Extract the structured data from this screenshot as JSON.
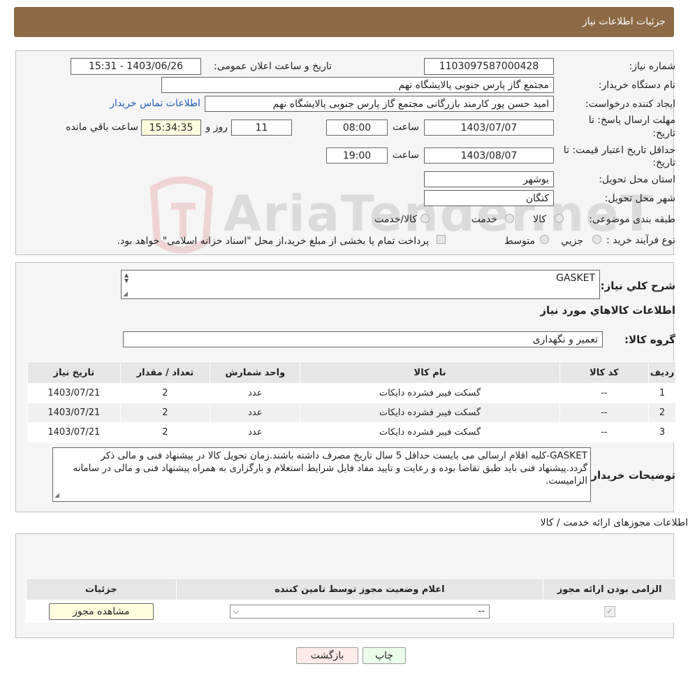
{
  "header": {
    "title": "جزئیات اطلاعات نیاز"
  },
  "form": {
    "need_number_label": "شماره نیاز:",
    "need_number": "1103097587000428",
    "announce_label": "تاریخ و ساعت اعلان عمومی:",
    "announce_value": "1403/06/26 - 15:31",
    "buyer_org_label": "نام دستگاه خریدار:",
    "buyer_org": "مجتمع گاز پارس جنوبی  پالایشگاه نهم",
    "creator_label": "ایجاد کننده درخواست:",
    "creator": "امید حسن پور کارمند بازرگانی مجتمع گاز پارس جنوبی  پالایشگاه نهم",
    "contact_link": "اطلاعات تماس خریدار",
    "deadline_label_1": "مهلت ارسال پاسخ: تا",
    "deadline_label_2": "تاریخ:",
    "deadline_date": "1403/07/07",
    "time_label": "ساعت",
    "deadline_time": "08:00",
    "days_value": "11",
    "days_label": "روز و",
    "remaining_time": "15:34:35",
    "remaining_label": "ساعت باقي مانده",
    "validity_label_1": "حداقل تاریخ اعتبار قیمت: تا",
    "validity_label_2": "تاریخ:",
    "validity_date": "1403/08/07",
    "validity_time": "19:00",
    "province_label": "استان محل تحویل:",
    "province": "بوشهر",
    "city_label": "شهر محل تحویل:",
    "city": "کنگان",
    "category_label": "طبقه بندی موضوعی:",
    "category_options": [
      "کالا",
      "خدمت",
      "کالا/خدمت"
    ],
    "process_label": "نوع فرآیند خرید :",
    "process_options": [
      "جزیي",
      "متوسط"
    ],
    "process_note": "پرداخت تمام یا بخشی از مبلغ خرید،از محل \"اسناد خزانه اسلامی\" خواهد بود."
  },
  "details": {
    "summary_label": "شرح كلي نياز:",
    "summary_value": "GASKET",
    "goods_heading": "اطلاعات كالاهاي مورد نياز",
    "group_label": "گروه کالا:",
    "group_value": "تعمیر و نگهداری",
    "columns": [
      "رديف",
      "كد كالا",
      "نام كالا",
      "واحد شمارش",
      "تعداد / مقدار",
      "تاريخ نياز"
    ],
    "rows": [
      [
        "1",
        "--",
        "گسکت فیبر فشرده دایکات",
        "عدد",
        "2",
        "1403/07/21"
      ],
      [
        "2",
        "--",
        "گسکت فیبر فشرده دایکات",
        "عدد",
        "2",
        "1403/07/21"
      ],
      [
        "3",
        "--",
        "گسکت فیبر فشرده دایکات",
        "عدد",
        "2",
        "1403/07/21"
      ]
    ],
    "buyer_notes_label": "توضیحات خریدار:",
    "buyer_notes": "GASKET-کلیه اقلام ارسالی می بایست حداقل 5 سال تاریخ مصرف داشته باشند.زمان تحویل کالا در پیشنهاد فنی و مالی ذکر گردد.پیشنهاد فنی باید طبق تقاضا بوده و رعایت و تایید مفاد فایل شرایط استعلام و بارگزاری به همراه پیشنهاد فنی و مالی در سامانه الزامیست."
  },
  "permits": {
    "heading": "اطلاعات مجوزهای ارائه خدمت / کالا",
    "columns": [
      "الزامی بودن ارائه مجوز",
      "اعلام وضعیت مجوز توسط تامین کننده",
      "جزئیات"
    ],
    "status_value": "--",
    "view_button": "مشاهده مجوز"
  },
  "buttons": {
    "print": "چاپ",
    "back": "بازگشت"
  },
  "watermark": {
    "text": "AriaTender.neT"
  },
  "colors": {
    "header": "#8b6a44",
    "link": "#1f5fbf",
    "print_bg": "#eaffea",
    "back_bg": "#ffeaea"
  }
}
